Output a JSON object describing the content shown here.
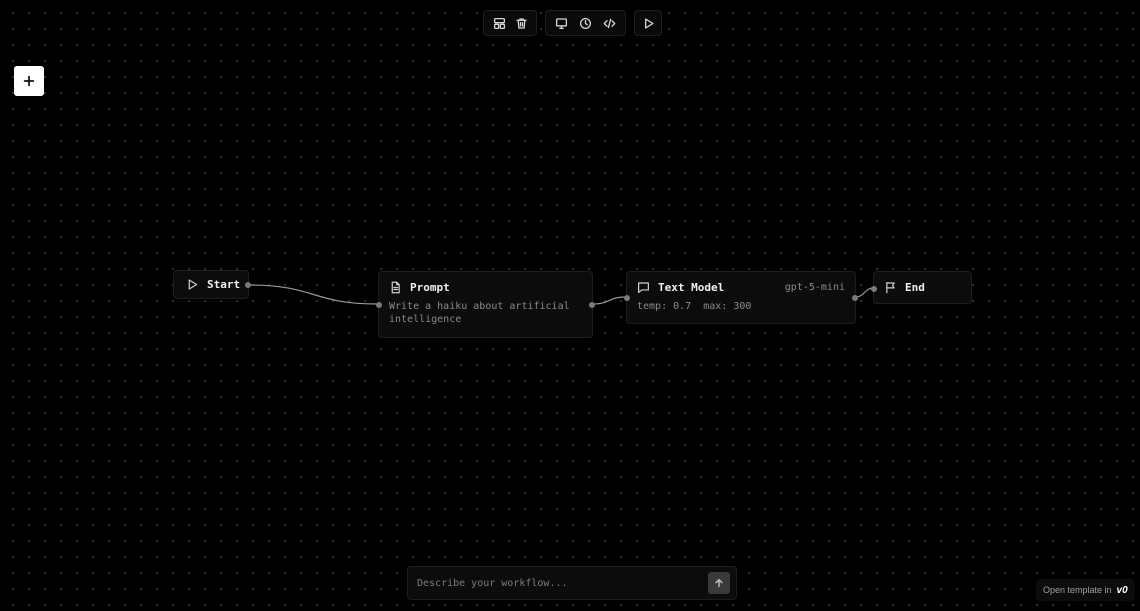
{
  "toolbar": {
    "group1": [
      {
        "name": "layout-icon",
        "label": "Layout"
      },
      {
        "name": "trash-icon",
        "label": "Delete"
      }
    ],
    "group2": [
      {
        "name": "monitor-icon",
        "label": "Preview"
      },
      {
        "name": "clock-icon",
        "label": "History"
      },
      {
        "name": "code-icon",
        "label": "Code"
      }
    ],
    "group3": [
      {
        "name": "play-icon",
        "label": "Run"
      }
    ]
  },
  "canvas": {
    "add_button_icon": "plus-icon",
    "nodes": {
      "start": {
        "title": "Start",
        "icon": "play-icon"
      },
      "prompt": {
        "title": "Prompt",
        "icon": "document-icon",
        "content": "Write a haiku about artificial intelligence"
      },
      "text_model": {
        "title": "Text Model",
        "icon": "message-icon",
        "model": "gpt-5-mini",
        "params": "temp: 0.7  max: 300"
      },
      "end": {
        "title": "End",
        "icon": "flag-icon"
      }
    }
  },
  "composer": {
    "placeholder": "Describe your workflow...",
    "send_icon": "arrow-up-icon"
  },
  "footer": {
    "open_template_label": "Open template in",
    "brand": "v0"
  },
  "colors": {
    "background": "#000000",
    "node_bg": "#0c0c0c",
    "edge": "#9a9a9a"
  }
}
